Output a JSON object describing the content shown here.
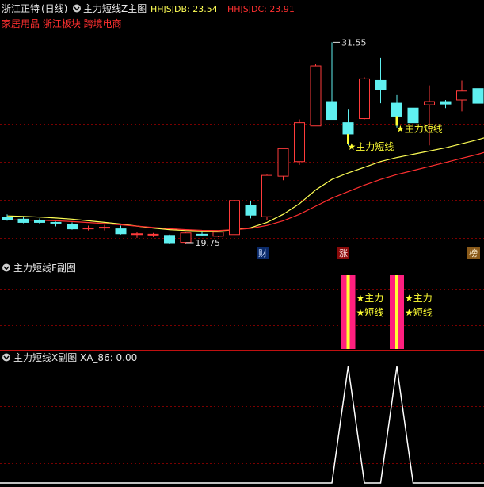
{
  "colors": {
    "background": "#000000",
    "up_candle": "#ff3b3b",
    "down_candle": "#5ff0f0",
    "hhjsjdb": "#ffff55",
    "hhjsjdc": "#ff3030",
    "signal_star": "#ffff33",
    "signal_bar_pink": "#ff1f7f",
    "signal_bar_yellow": "#ffff33",
    "xa_line": "#ffffff",
    "grid": "#7a0000",
    "divider": "#c01010",
    "title_text": "#e8e8e8"
  },
  "main_panel": {
    "stock_name": "浙江正特",
    "period": "(日线)",
    "indicator_title": "主力短线Z主图",
    "hhjsjdb_label": "HHJSJDB: 23.54",
    "hhjsjdc_label": "HHJSJDC: 23.91",
    "sector_tags": "家居用品 浙江板块 跨境电商",
    "high_marker": "31.55",
    "low_marker": "19.75",
    "signal_label": "★主力短线",
    "event_markers": [
      "财",
      "涨",
      "榜"
    ]
  },
  "sub_panel_f": {
    "title": "主力短线F副图",
    "signal_line1": "★主力",
    "signal_line2": "★短线"
  },
  "sub_panel_x": {
    "title": "主力短线X副图",
    "value_label": "XA_86: 0.00"
  },
  "chart_data": [
    {
      "type": "candlestick",
      "title": "浙江正特 (日线)",
      "ylim": [
        19.2,
        32.4
      ],
      "candles": [
        {
          "o": 20.75,
          "h": 20.95,
          "l": 20.55,
          "c": 20.6
        },
        {
          "o": 20.65,
          "h": 20.8,
          "l": 20.4,
          "c": 20.45
        },
        {
          "o": 20.55,
          "h": 20.7,
          "l": 20.35,
          "c": 20.45
        },
        {
          "o": 20.45,
          "h": 20.5,
          "l": 20.2,
          "c": 20.42
        },
        {
          "o": 20.3,
          "h": 20.45,
          "l": 20.0,
          "c": 20.05
        },
        {
          "o": 20.05,
          "h": 20.25,
          "l": 19.95,
          "c": 20.1
        },
        {
          "o": 20.1,
          "h": 20.3,
          "l": 19.95,
          "c": 20.15
        },
        {
          "o": 20.05,
          "h": 20.25,
          "l": 19.7,
          "c": 19.75
        },
        {
          "o": 19.75,
          "h": 19.85,
          "l": 19.5,
          "c": 19.75
        },
        {
          "o": 19.7,
          "h": 19.8,
          "l": 19.55,
          "c": 19.72
        },
        {
          "o": 19.65,
          "h": 19.7,
          "l": 19.15,
          "c": 19.2
        },
        {
          "o": 19.22,
          "h": 19.85,
          "l": 19.1,
          "c": 19.8
        },
        {
          "o": 19.72,
          "h": 19.9,
          "l": 19.6,
          "c": 19.68
        },
        {
          "o": 19.6,
          "h": 19.9,
          "l": 19.55,
          "c": 19.85
        },
        {
          "o": 19.7,
          "h": 21.8,
          "l": 19.7,
          "c": 21.8
        },
        {
          "o": 21.5,
          "h": 21.75,
          "l": 20.7,
          "c": 20.9
        },
        {
          "o": 20.8,
          "h": 23.4,
          "l": 20.6,
          "c": 23.35
        },
        {
          "o": 23.3,
          "h": 25.0,
          "l": 23.05,
          "c": 25.0
        },
        {
          "o": 24.2,
          "h": 26.8,
          "l": 24.0,
          "c": 26.6
        },
        {
          "o": 26.4,
          "h": 30.2,
          "l": 26.4,
          "c": 30.1
        },
        {
          "o": 27.9,
          "h": 31.55,
          "l": 27.2,
          "c": 26.8
        },
        {
          "o": 26.6,
          "h": 27.4,
          "l": 25.2,
          "c": 25.9
        },
        {
          "o": 26.85,
          "h": 29.4,
          "l": 26.8,
          "c": 29.3
        },
        {
          "o": 29.2,
          "h": 30.6,
          "l": 27.8,
          "c": 28.65
        },
        {
          "o": 27.8,
          "h": 28.3,
          "l": 26.3,
          "c": 27.0
        },
        {
          "o": 27.5,
          "h": 28.3,
          "l": 26.45,
          "c": 26.6
        },
        {
          "o": 27.7,
          "h": 28.9,
          "l": 25.2,
          "c": 27.9
        },
        {
          "o": 27.9,
          "h": 28.0,
          "l": 27.5,
          "c": 27.75
        },
        {
          "o": 28.0,
          "h": 29.2,
          "l": 27.3,
          "c": 28.55
        },
        {
          "o": 28.7,
          "h": 30.4,
          "l": 27.9,
          "c": 27.8
        },
        {
          "o": 27.0,
          "h": 30.4,
          "l": 26.6,
          "c": 29.0
        },
        {
          "o": 27.55,
          "h": 28.0,
          "l": 26.8,
          "c": 27.6
        }
      ],
      "series": [
        {
          "name": "HHJSJDB",
          "values": [
            20.85,
            20.82,
            20.78,
            20.72,
            20.65,
            20.55,
            20.45,
            20.35,
            20.22,
            20.1,
            20.0,
            19.95,
            19.92,
            19.92,
            20.0,
            20.12,
            20.45,
            20.95,
            21.6,
            22.45,
            23.1,
            23.5,
            23.85,
            24.2,
            24.45,
            24.65,
            24.85,
            25.05,
            25.3,
            25.55,
            25.85,
            26.2
          ]
        },
        {
          "name": "HHJSJDC",
          "values": [
            20.6,
            20.6,
            20.58,
            20.55,
            20.5,
            20.44,
            20.38,
            20.3,
            20.22,
            20.14,
            20.06,
            20.0,
            19.96,
            19.95,
            20.0,
            20.08,
            20.26,
            20.55,
            20.95,
            21.45,
            21.95,
            22.35,
            22.75,
            23.1,
            23.4,
            23.65,
            23.9,
            24.15,
            24.4,
            24.65,
            24.95,
            25.25
          ]
        }
      ],
      "annotations": [
        {
          "x_index": 20,
          "text": "31.55",
          "type": "high"
        },
        {
          "x_index": 11,
          "text": "19.75",
          "type": "low"
        },
        {
          "x_index": 21,
          "text": "★主力短线",
          "type": "signal"
        },
        {
          "x_index": 24,
          "text": "★主力短线",
          "type": "signal"
        }
      ]
    },
    {
      "type": "bar",
      "title": "主力短线F副图",
      "signal_indices": [
        21,
        24
      ],
      "values": [
        0,
        0,
        0,
        0,
        0,
        0,
        0,
        0,
        0,
        0,
        0,
        0,
        0,
        0,
        0,
        0,
        0,
        0,
        0,
        0,
        0,
        1,
        0,
        0,
        1,
        0,
        0,
        0,
        0,
        0,
        0,
        0
      ]
    },
    {
      "type": "line",
      "title": "主力短线X副图",
      "series": [
        {
          "name": "XA_86",
          "values": [
            0,
            0,
            0,
            0,
            0,
            0,
            0,
            0,
            0,
            0,
            0,
            0,
            0,
            0,
            0,
            0,
            0,
            0,
            0,
            0,
            0,
            1,
            0,
            0,
            1,
            0,
            0,
            0,
            0,
            0,
            0,
            0
          ]
        }
      ]
    }
  ]
}
